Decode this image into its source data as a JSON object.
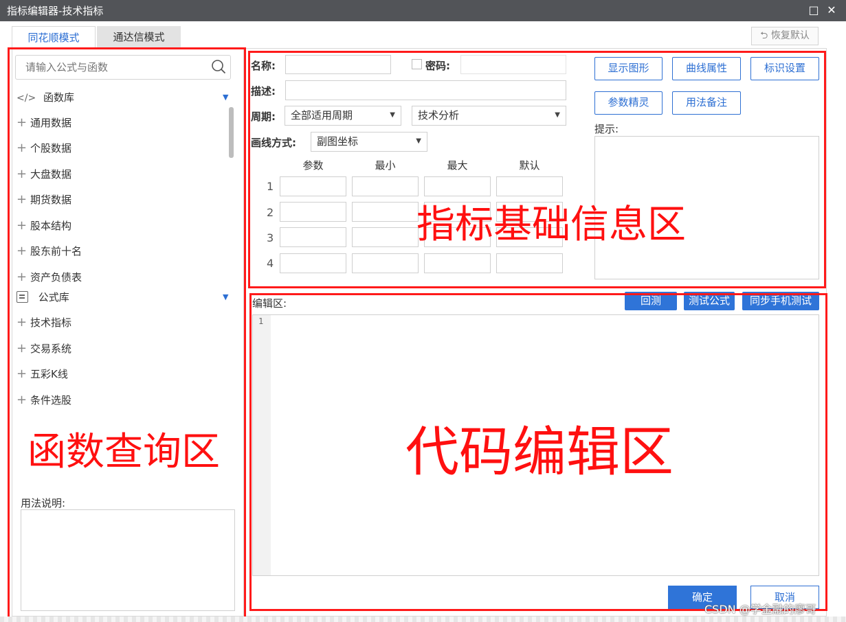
{
  "window": {
    "title": "指标编辑器-技术指标",
    "maximize": "□",
    "close": "✕"
  },
  "tabs": [
    {
      "label": "同花顺模式"
    },
    {
      "label": "通达信模式"
    }
  ],
  "restore_default": "恢复默认",
  "search": {
    "placeholder": "请输入公式与函数"
  },
  "function_lib": {
    "title": "函数库",
    "items": [
      "通用数据",
      "个股数据",
      "大盘数据",
      "期货数据",
      "股本结构",
      "股东前十名",
      "资产负债表"
    ]
  },
  "formula_lib": {
    "title": "公式库",
    "items": [
      "技术指标",
      "交易系统",
      "五彩K线",
      "条件选股"
    ]
  },
  "usage_label": "用法说明:",
  "form": {
    "name_label": "名称:",
    "password_label": "密码:",
    "desc_label": "描述:",
    "period_label": "周期:",
    "period_value": "全部适用周期",
    "category_value": "技术分析",
    "draw_label": "画线方式:",
    "draw_value": "副图坐标"
  },
  "params": {
    "headers": [
      "参数",
      "最小",
      "最大",
      "默认"
    ],
    "rows": [
      "1",
      "2",
      "3",
      "4"
    ]
  },
  "buttons": {
    "show_graph": "显示图形",
    "curve_props": "曲线属性",
    "mark_settings": "标识设置",
    "param_wizard": "参数精灵",
    "usage_notes": "用法备注",
    "backtest": "回测",
    "test_formula": "测试公式",
    "sync_mobile": "同步手机测试",
    "ok": "确定",
    "cancel": "取消"
  },
  "hint_label": "提示:",
  "editor": {
    "label": "编辑区:",
    "line1": "1"
  },
  "annotations": {
    "function_query": "函数查询区",
    "basic_info": "指标基础信息区",
    "code_edit": "代码编辑区"
  },
  "watermark": "CSDN @学金融的廖哥"
}
